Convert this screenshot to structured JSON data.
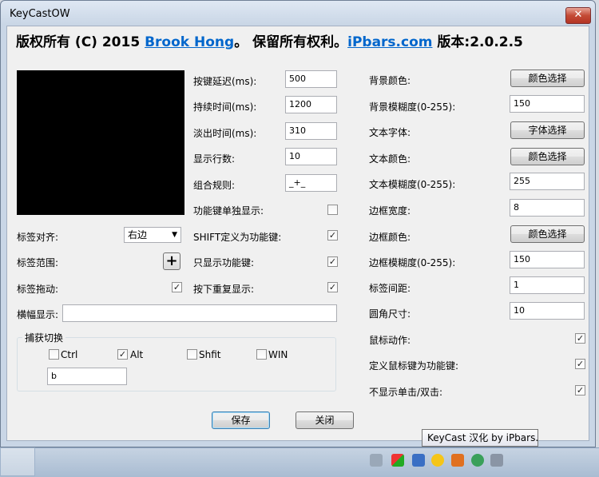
{
  "window": {
    "title": "KeyCastOW",
    "close_glyph": "✕"
  },
  "header": {
    "prefix": "版权所有 (C) 2015 ",
    "author_link": "Brook Hong",
    "middle": "。 保留所有权利。",
    "site_link": "iPbars.com",
    "version": " 版本:2.0.2.5"
  },
  "left": {
    "align_label": "标签对齐:",
    "align_value": "右边",
    "range_label": "标签范围:",
    "range_button": "+",
    "drag_label": "标签拖动:",
    "drag_checked": "✓",
    "banner_label": "横幅显示:",
    "banner_value": ""
  },
  "capture": {
    "title": "捕获切换",
    "ctrl": "Ctrl",
    "alt": "Alt",
    "shift": "Shfit",
    "win": "WIN",
    "ctrl_mark": "",
    "alt_mark": "✓",
    "shift_mark": "",
    "win_mark": "",
    "key_value": "b"
  },
  "middle": {
    "delay_label": "按键延迟(ms):",
    "delay_value": "500",
    "duration_label": "持续时间(ms):",
    "duration_value": "1200",
    "fade_label": "淡出时间(ms):",
    "fade_value": "310",
    "lines_label": "显示行数:",
    "lines_value": "10",
    "combo_label": "组合规则:",
    "combo_value": "_+_",
    "fnkey_label": "功能键单独显示:",
    "fnkey_mark": "",
    "shift_fn_label": "SHIFT定义为功能键:",
    "shift_fn_mark": "✓",
    "only_fn_label": "只显示功能键:",
    "only_fn_mark": "✓",
    "repeat_label": "按下重复显示:",
    "repeat_mark": "✓"
  },
  "right": {
    "bg_color_label": "背景颜色:",
    "bg_color_button": "颜色选择",
    "bg_opacity_label": "背景模糊度(0-255):",
    "bg_opacity_value": "150",
    "font_label": "文本字体:",
    "font_button": "字体选择",
    "text_color_label": "文本颜色:",
    "text_color_button": "颜色选择",
    "text_opacity_label": "文本模糊度(0-255):",
    "text_opacity_value": "255",
    "border_width_label": "边框宽度:",
    "border_width_value": "8",
    "border_color_label": "边框颜色:",
    "border_color_button": "颜色选择",
    "border_opacity_label": "边框模糊度(0-255):",
    "border_opacity_value": "150",
    "spacing_label": "标签间距:",
    "spacing_value": "1",
    "radius_label": "圆角尺寸:",
    "radius_value": "10",
    "mouse_label": "鼠标动作:",
    "mouse_mark": "✓",
    "mouse_fn_label": "定义鼠标键为功能键:",
    "mouse_fn_mark": "✓",
    "noclick_label": "不显示单击/双击:",
    "noclick_mark": "✓"
  },
  "buttons": {
    "save": "保存",
    "close": "关闭"
  },
  "tooltip": {
    "text": "KeyCast 汉化 by iPbars.com"
  },
  "colors": {
    "link": "#0066cc",
    "close_button": "#c44a35",
    "preview": "#000000"
  }
}
